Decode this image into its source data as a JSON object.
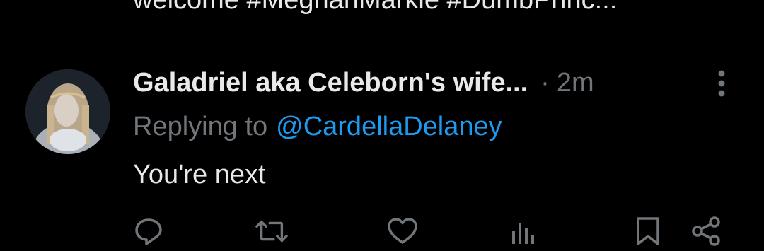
{
  "previous_tweet": {
    "text": "welcome #MeghanMarkle #DumbPrinc..."
  },
  "reply": {
    "display_name": "Galadriel aka Celeborn's wife...",
    "separator": "·",
    "timestamp": "2m",
    "replying_to_label": "Replying to",
    "replying_to_handle": "@CardellaDelaney",
    "text": "You're next"
  },
  "icons": {
    "more": "more-vertical-icon",
    "reply": "reply-icon",
    "retweet": "retweet-icon",
    "like": "heart-icon",
    "views": "views-icon",
    "bookmark": "bookmark-icon",
    "share": "share-icon"
  },
  "colors": {
    "background": "#000000",
    "primary_text": "#e7e9ea",
    "secondary_text": "#71767b",
    "accent": "#1d9bf0",
    "divider": "#2f3336"
  }
}
